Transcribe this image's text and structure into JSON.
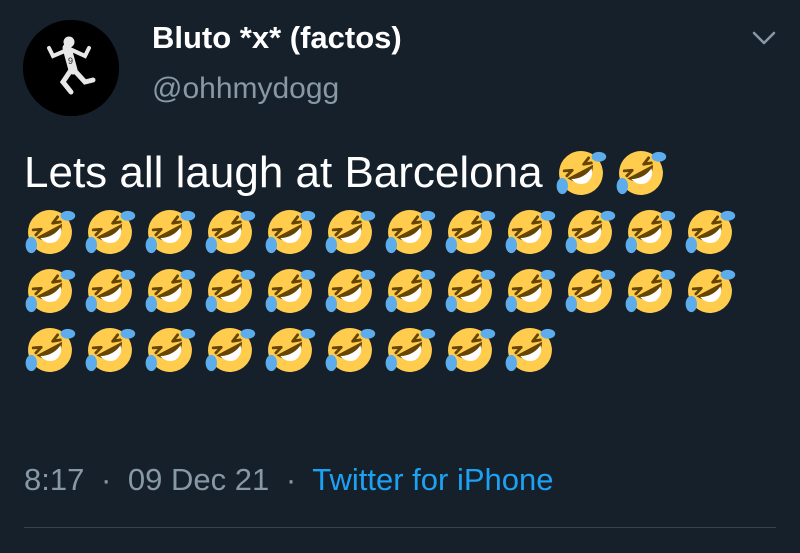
{
  "tweet": {
    "author": {
      "display_name": "Bluto *x* (factos)",
      "handle": "@ohhmydogg",
      "avatar_icon": "soccer-player-celebration-avatar"
    },
    "menu_icon": "chevron-down-icon",
    "text": "Lets all laugh at Barcelona",
    "emoji_icon": "rolling-on-the-floor-laughing-emoji",
    "emoji_count": 35,
    "time": "8:17",
    "date": "09 Dec 21",
    "separator": "·",
    "source": "Twitter for iPhone"
  },
  "colors": {
    "background": "#15202b",
    "text_primary": "#ffffff",
    "text_secondary": "#8899a6",
    "link": "#1da1f2",
    "divider": "#38444d"
  }
}
